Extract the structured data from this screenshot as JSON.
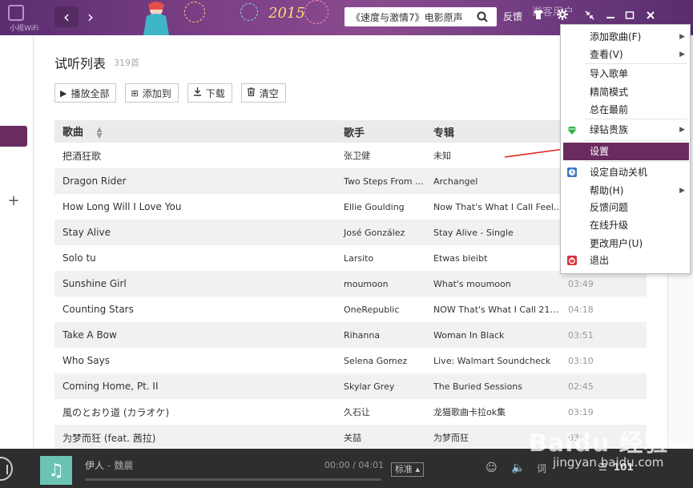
{
  "header": {
    "logo_text": "小视WiFi",
    "year_text": "2015",
    "search_value": "《速度与激情7》电影原声",
    "feedback_label": "反馈",
    "user_label": "游客用户",
    "accent_color": "#6a2c60"
  },
  "playlist": {
    "title": "试听列表",
    "count": "319首",
    "toolbar": {
      "play_all": "播放全部",
      "add_to": "添加到",
      "download": "下载",
      "clear": "清空"
    },
    "columns": {
      "song": "歌曲",
      "artist": "歌手",
      "album": "专辑"
    },
    "rows": [
      {
        "song": "把酒狂歌",
        "artist": "张卫健",
        "album": "未知",
        "duration": ""
      },
      {
        "song": "Dragon Rider",
        "artist": "Two Steps From ...",
        "album": "Archangel",
        "duration": ""
      },
      {
        "song": "How Long Will I Love You",
        "artist": "Ellie Goulding",
        "album": "Now That's What I Call Feel ...",
        "duration": ""
      },
      {
        "song": "Stay Alive",
        "artist": "José González",
        "album": "Stay Alive - Single",
        "duration": ""
      },
      {
        "song": "Solo tu",
        "artist": "Larsito",
        "album": "Etwas bleibt",
        "duration": ""
      },
      {
        "song": "Sunshine Girl",
        "artist": "moumoon",
        "album": "What's moumoon",
        "duration": "03:49"
      },
      {
        "song": "Counting Stars",
        "artist": "OneRepublic",
        "album": "NOW That's What I Call 21st...",
        "duration": "04:18"
      },
      {
        "song": "Take A Bow",
        "artist": "Rihanna",
        "album": "Woman In Black",
        "duration": "03:51"
      },
      {
        "song": "Who Says",
        "artist": "Selena Gomez",
        "album": "Live: Walmart Soundcheck",
        "duration": "03:10"
      },
      {
        "song": "Coming Home, Pt. II",
        "artist": "Skylar Grey",
        "album": "The Buried Sessions",
        "duration": "02:45"
      },
      {
        "song": "風のとおり道 (カラオケ)",
        "artist": "久石让",
        "album": "龙猫歌曲卡拉ok集",
        "duration": "03:19"
      },
      {
        "song": "为梦而狂 (feat. 茜拉)",
        "artist": "关喆",
        "album": "为梦而狂",
        "duration": "03:..."
      }
    ]
  },
  "menu": {
    "items": [
      {
        "label": "添加歌曲(F)",
        "submenu": true
      },
      {
        "label": "查看(V)",
        "submenu": true
      },
      {
        "label": "导入歌单"
      },
      {
        "label": "精简模式"
      },
      {
        "label": "总在最前"
      },
      {
        "label": "绿钻贵族",
        "submenu": true
      },
      {
        "label": "设置",
        "highlighted": true
      },
      {
        "label": "设定自动关机"
      },
      {
        "label": "帮助(H)",
        "submenu": true
      },
      {
        "label": "反馈问题"
      },
      {
        "label": "在线升级"
      },
      {
        "label": "更改用户(U)"
      },
      {
        "label": "退出"
      }
    ]
  },
  "player": {
    "song": "伊人",
    "artist": "魏晨",
    "time": "00:00 / 04:01",
    "progress": 0,
    "quality": "标准",
    "queue_count": "101"
  },
  "watermark": {
    "main": "Baidu 经验",
    "sub": "jingyan.baidu.com"
  }
}
